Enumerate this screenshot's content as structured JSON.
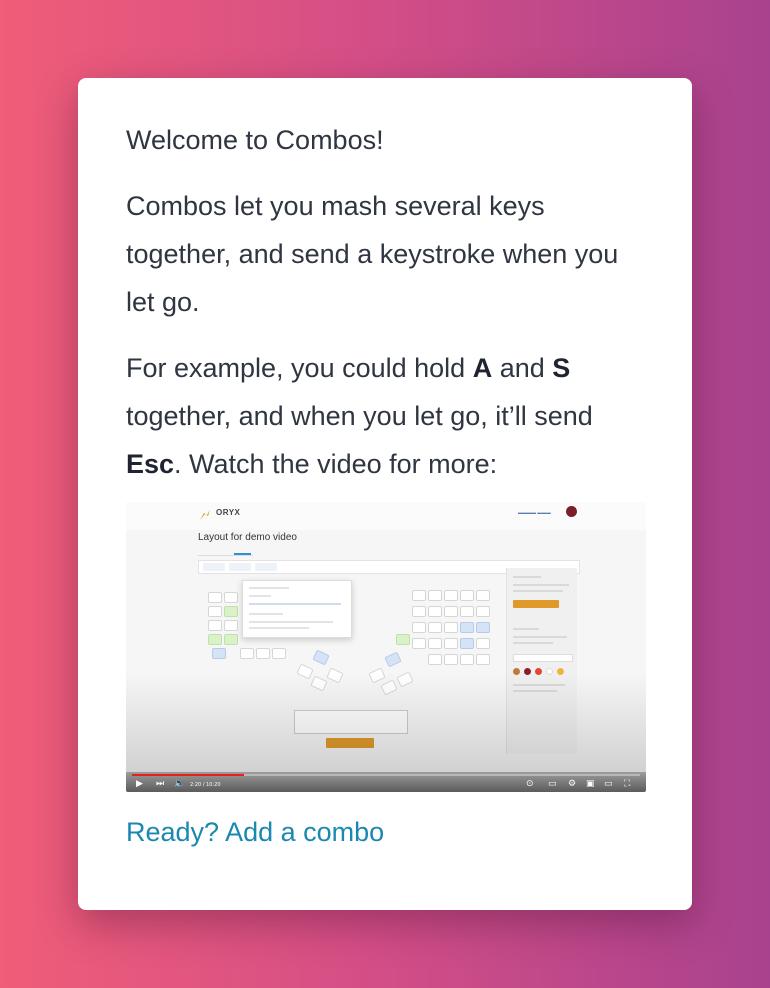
{
  "welcome": {
    "text": "Welcome to Combos!"
  },
  "description": {
    "text": "Combos let you mash several keys together, and send a keystroke when you let go."
  },
  "example": {
    "part1": "For example, you could hold ",
    "key_a": "A",
    "part2": " and ",
    "key_s": "S",
    "part3": " together, and when you let go, it’ll send ",
    "key_esc": "Esc",
    "part4": ". Watch the video for more:"
  },
  "video": {
    "brand": "ORYX",
    "heading": "Layout for demo video",
    "timecode": "2:20 / 10:20",
    "progress_fraction": 0.22
  },
  "cta": {
    "label": "Ready? Add a combo"
  },
  "colors": {
    "text": "#2f3541",
    "link": "#1a88b0",
    "gradient_start": "#ef5d78",
    "gradient_end": "#a9428e"
  }
}
